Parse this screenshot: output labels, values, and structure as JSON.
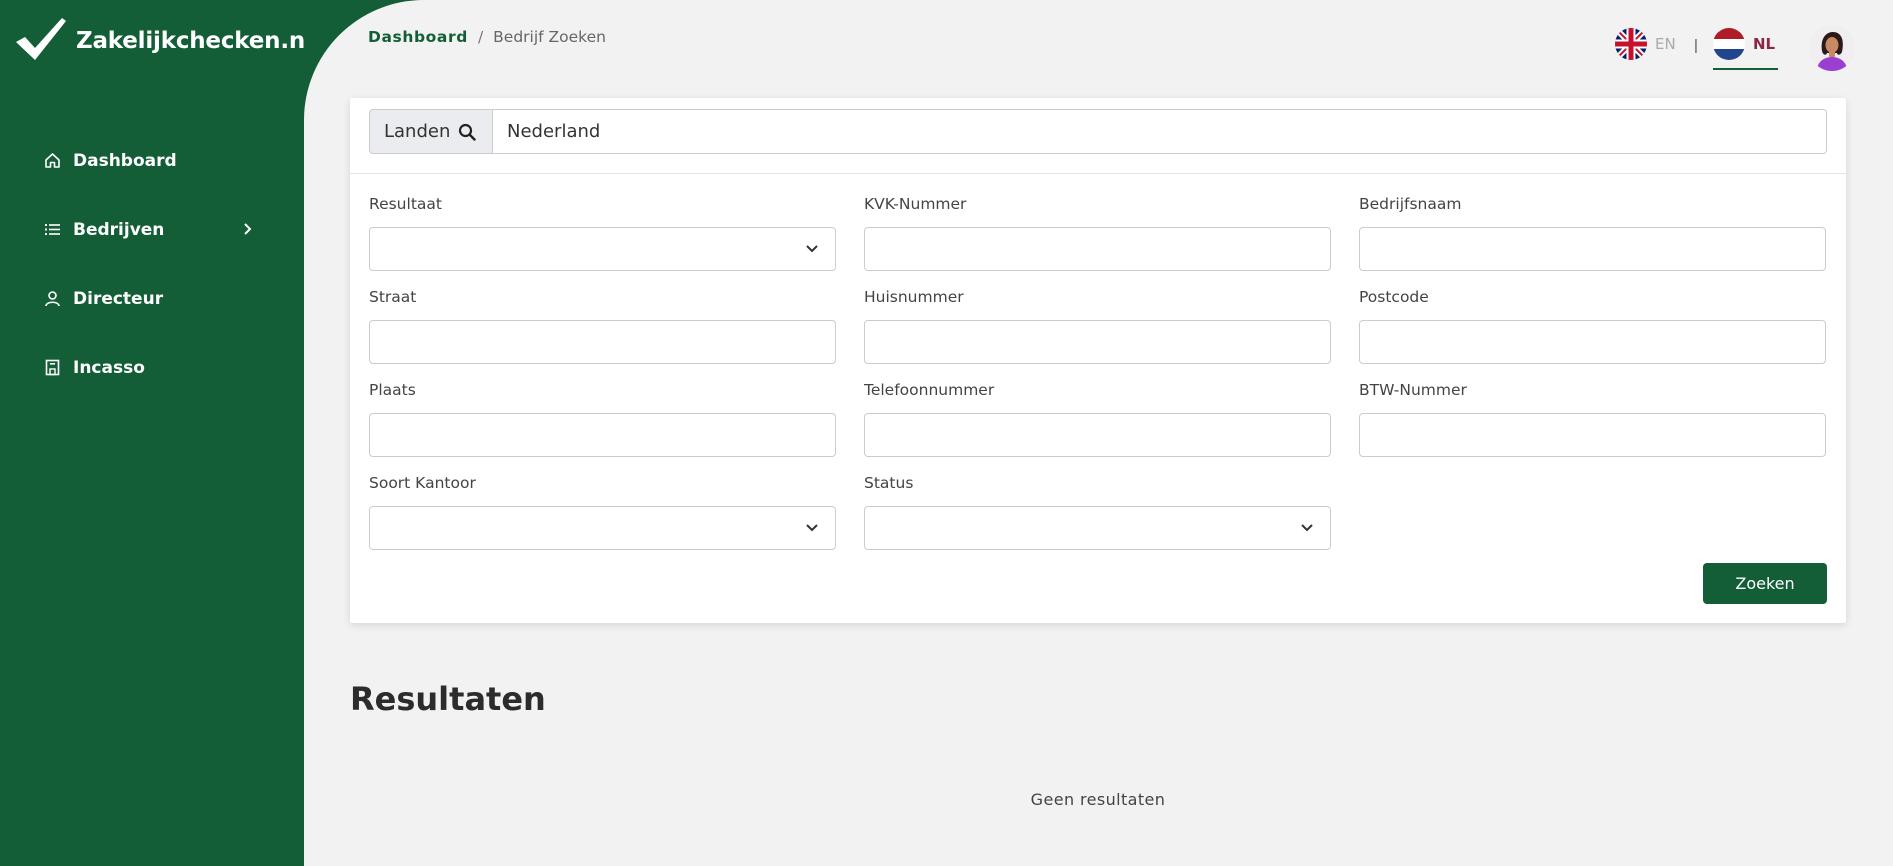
{
  "brand": {
    "name": "Zakelijkchecken.nl"
  },
  "sidebar": {
    "items": [
      {
        "label": "Dashboard",
        "icon": "home-icon"
      },
      {
        "label": "Bedrijven",
        "icon": "list-icon",
        "has_submenu": true
      },
      {
        "label": "Directeur",
        "icon": "user-icon"
      },
      {
        "label": "Incasso",
        "icon": "building-icon"
      }
    ]
  },
  "breadcrumb": {
    "home": "Dashboard",
    "separator": "/",
    "current": "Bedrijf Zoeken"
  },
  "language": {
    "en": "EN",
    "divider": "|",
    "nl": "NL",
    "active": "NL"
  },
  "search": {
    "country_label": "Landen",
    "country_value": "Nederland",
    "fields": [
      {
        "label": "Resultaat",
        "type": "select",
        "value": ""
      },
      {
        "label": "KVK-Nummer",
        "type": "text",
        "value": ""
      },
      {
        "label": "Bedrijfsnaam",
        "type": "text",
        "value": ""
      },
      {
        "label": "Straat",
        "type": "text",
        "value": ""
      },
      {
        "label": "Huisnummer",
        "type": "text",
        "value": ""
      },
      {
        "label": "Postcode",
        "type": "text",
        "value": ""
      },
      {
        "label": "Plaats",
        "type": "text",
        "value": ""
      },
      {
        "label": "Telefoonnummer",
        "type": "text",
        "value": ""
      },
      {
        "label": "BTW-Nummer",
        "type": "text",
        "value": ""
      },
      {
        "label": "Soort Kantoor",
        "type": "select",
        "value": ""
      },
      {
        "label": "Status",
        "type": "select",
        "value": ""
      }
    ],
    "submit_label": "Zoeken"
  },
  "results": {
    "title": "Resultaten",
    "empty_text": "Geen resultaten"
  },
  "colors": {
    "primary": "#135e36",
    "background": "#f2f2f2",
    "nl_accent": "#8a2747"
  }
}
